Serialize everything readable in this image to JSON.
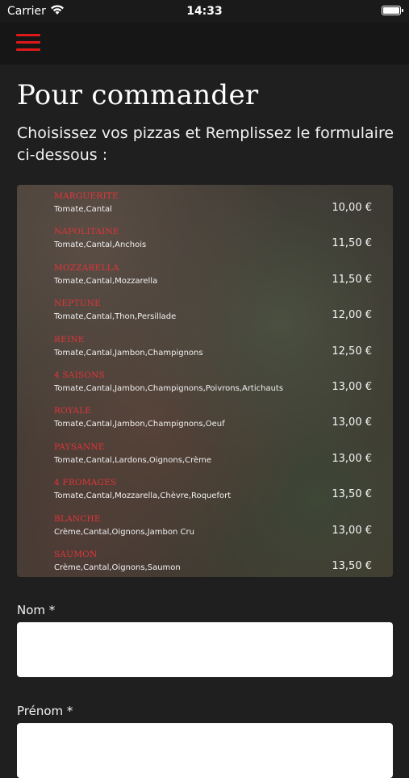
{
  "status_bar": {
    "carrier": "Carrier",
    "time": "14:33"
  },
  "header": {
    "title": "Pour commander",
    "intro": "Choisissez vos pizzas et Remplissez le formulaire ci-dessous :"
  },
  "menu": [
    {
      "name": "MARGUERITE",
      "ingredients": "Tomate,Cantal",
      "price": "10,00 €"
    },
    {
      "name": "NAPOLITAINE",
      "ingredients": "Tomate,Cantal,Anchois",
      "price": "11,50 €"
    },
    {
      "name": "MOZZARELLA",
      "ingredients": "Tomate,Cantal,Mozzarella",
      "price": "11,50 €"
    },
    {
      "name": "NEPTUNE",
      "ingredients": "Tomate,Cantal,Thon,Persillade",
      "price": "12,00 €"
    },
    {
      "name": "REINE",
      "ingredients": "Tomate,Cantal,Jambon,Champignons",
      "price": "12,50 €"
    },
    {
      "name": "4 SAISONS",
      "ingredients": "Tomate,Cantal,Jambon,Champignons,Poivrons,Artichauts",
      "price": "13,00 €"
    },
    {
      "name": "ROYALE",
      "ingredients": "Tomate,Cantal,Jambon,Champignons,Oeuf",
      "price": "13,00 €"
    },
    {
      "name": "PAYSANNE",
      "ingredients": "Tomate,Cantal,Lardons,Oignons,Crème",
      "price": "13,00 €"
    },
    {
      "name": "4 FROMAGES",
      "ingredients": "Tomate,Cantal,Mozzarella,Chèvre,Roquefort",
      "price": "13,50 €"
    },
    {
      "name": "BLANCHE",
      "ingredients": "Crème,Cantal,Oignons,Jambon Cru",
      "price": "13,00 €"
    },
    {
      "name": "SAUMON",
      "ingredients": "Crème,Cantal,Oignons,Saumon",
      "price": "13,50 €"
    }
  ],
  "form": {
    "nom_label": "Nom *",
    "nom_value": "",
    "prenom_label": "Prénom *",
    "prenom_value": ""
  },
  "colors": {
    "accent": "#e01818",
    "pizza_name": "#e3343a",
    "background": "#1f1f1f"
  }
}
